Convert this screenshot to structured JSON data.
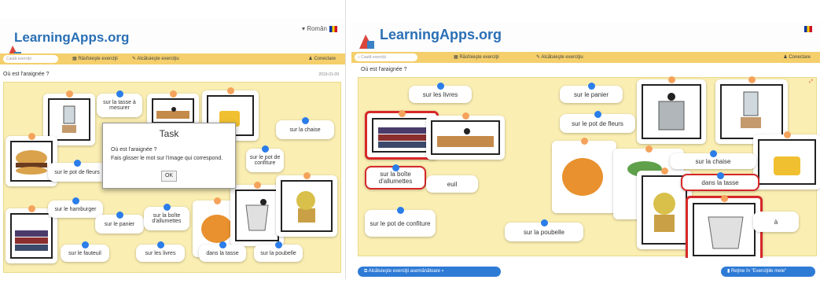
{
  "left_panel": {
    "brand": "LearningApps.org",
    "language": "Român",
    "search_placeholder": "Caută exerciţii",
    "nav": {
      "browse": "Răsfoieşte exerciţii",
      "create": "Alcătuieşte exerciţiu",
      "login": "Conectare"
    },
    "title": "Où est l'araignée ?",
    "date": "2019-01-09",
    "labels": {
      "tasse_mesurer": "sur la tasse à mesurer",
      "chaise": "sur la chaise",
      "pot_fleurs": "sur le pot de fleurs",
      "pot_confiture": "sur le pot de confiture",
      "hamburger": "sur le hamburger",
      "panier": "sur le panier",
      "boite_allumettes": "sur la boîte d'allumettes",
      "fauteuil": "sur le fauteuil",
      "livres": "sur les livres",
      "dans_tasse": "dans la tasse",
      "poubelle": "sur la poubelle"
    },
    "dialog": {
      "title": "Task",
      "question": "Où est l'araignée ?",
      "instruction": "Fais glisser le mot sur l'image qui correspond.",
      "ok": "OK"
    }
  },
  "right_panel": {
    "brand": "LearningApps.org",
    "search_placeholder": "Caută exerciţii",
    "nav": {
      "browse": "Răsfoieşte exerciţii",
      "create": "Alcătuieşte exerciţiu",
      "login": "Conectare"
    },
    "title": "Où est l'araignée ?",
    "labels": {
      "livres": "sur les livres",
      "panier": "sur le panier",
      "pot_fleurs": "sur le pot de fleurs",
      "boite_allumettes": "sur la boîte d'allumettes",
      "fauteuil_partial": "euil",
      "chaise": "sur la chaise",
      "dans_tasse": "dans la tasse",
      "pot_confiture": "sur le pot de confiture",
      "poubelle": "sur la poubelle",
      "a_partial": "à"
    },
    "footer": {
      "create_similar": "Alcătuieşte exerciţii asemănătoare",
      "save": "Reţine în \"Exerciţiile mele\""
    }
  },
  "colors": {
    "brand_blue": "#2a6fb5",
    "nav_yellow": "#f4cf6b",
    "board": "#faeeb2",
    "correct_red": "#d62828",
    "dot_blue": "#2b7de9",
    "dot_orange": "#f5a35c"
  }
}
